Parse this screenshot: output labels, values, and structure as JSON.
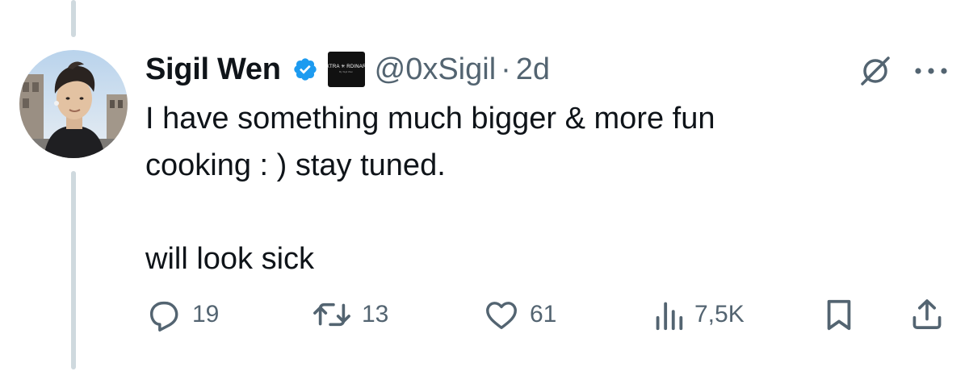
{
  "author": {
    "display_name": "Sigil Wen",
    "handle": "@0xSigil",
    "timestamp": "2d",
    "separator": "·",
    "verified": true,
    "affiliate_badge": {
      "text": "EXTRA ✳ RDINARY",
      "subtext": "By Sigil Wen"
    }
  },
  "tweet": {
    "lines": [
      "I have something much bigger & more fun",
      "cooking : ) stay tuned.",
      "will look sick"
    ]
  },
  "actions": {
    "replies": "19",
    "retweets": "13",
    "likes": "61",
    "views": "7,5K"
  },
  "icons": {
    "reply": "reply-icon",
    "retweet": "retweet-icon",
    "like": "like-icon",
    "views": "views-icon",
    "bookmark": "bookmark-icon",
    "share": "share-icon",
    "grok": "grok-icon",
    "more": "more-icon",
    "verified": "verified-badge-icon"
  },
  "colors": {
    "verified": "#1d9bf0",
    "secondary_text": "#536471",
    "thread_line": "#cfd9de"
  }
}
